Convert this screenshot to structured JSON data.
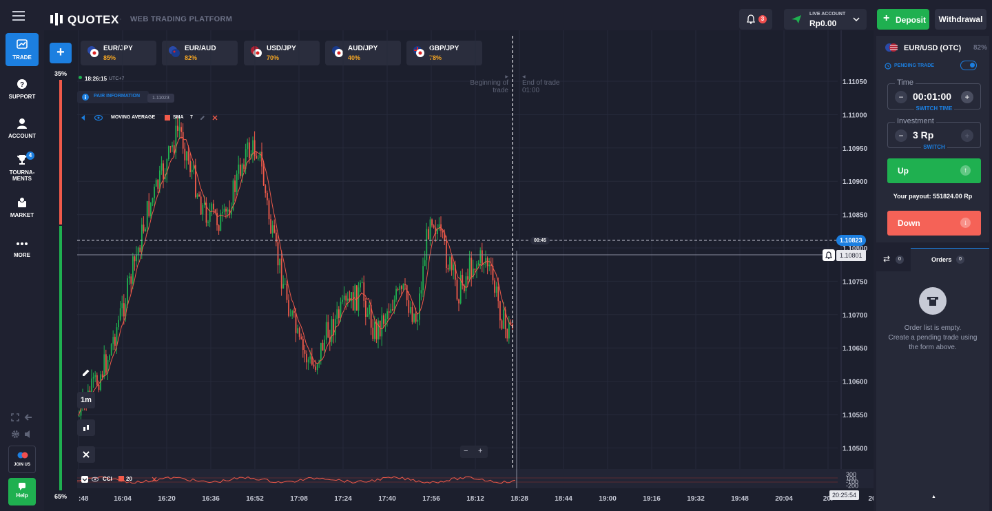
{
  "header": {
    "logo_text": "QUOTEX",
    "logo_sep": "·",
    "platform_label": "WEB TRADING PLATFORM",
    "notification_count": "3",
    "account_label": "LIVE ACCOUNT",
    "balance": "Rp0.00",
    "deposit_label": "Deposit",
    "withdraw_label": "Withdrawal"
  },
  "sidebar": {
    "items": [
      {
        "label": "TRADE",
        "icon": "chart-icon"
      },
      {
        "label": "SUPPORT",
        "icon": "help-icon"
      },
      {
        "label": "ACCOUNT",
        "icon": "user-icon"
      },
      {
        "label": "TOURNA-\nMENTS",
        "label1": "TOURNA-",
        "label2": "MENTS",
        "icon": "trophy-icon",
        "badge": "4"
      },
      {
        "label": "MARKET",
        "icon": "market-icon"
      },
      {
        "label": "MORE",
        "icon": "more-icon"
      }
    ],
    "join_label": "JOIN US",
    "help_label": "Help"
  },
  "assets": [
    {
      "name": "EUR/JPY",
      "payout": "85%"
    },
    {
      "name": "EUR/AUD",
      "payout": "82%"
    },
    {
      "name": "USD/JPY",
      "payout": "70%"
    },
    {
      "name": "AUD/JPY",
      "payout": "40%"
    },
    {
      "name": "GBP/JPY",
      "payout": "78%"
    }
  ],
  "chart": {
    "sentiment_up": "35%",
    "sentiment_down": "65%",
    "clock": "18:26:15",
    "timezone": "UTC+7",
    "pair_info_label": "PAIR INFORMATION",
    "hover_price": "1.11023",
    "indicator_name": "MOVING AVERAGE",
    "indicator_type": "SMA",
    "indicator_period": "7",
    "begin_trade_label": "Beginning of trade",
    "end_trade_label": "End of trade",
    "end_trade_time": "01:00",
    "countdown": "00:45",
    "current_price": "1.10823",
    "alert_price": "1.10801",
    "timeframe": "1m",
    "cci_label": "CCI",
    "cci_period": "20",
    "cci_ticks": [
      "300",
      "100",
      "-100",
      "-200"
    ],
    "cursor_time": "20:25:54",
    "zoom_minus": "−",
    "zoom_plus": "+",
    "price_ticks": [
      "1.11050",
      "1.11000",
      "1.10950",
      "1.10900",
      "1.10850",
      "1.10800",
      "1.10750",
      "1.10700",
      "1.10650",
      "1.10600",
      "1.10550",
      "1.10500"
    ],
    "time_ticks": [
      ":48",
      "16:04",
      "16:20",
      "16:36",
      "16:52",
      "17:08",
      "17:24",
      "17:40",
      "17:56",
      "18:12",
      "18:28",
      "18:44",
      "19:00",
      "19:16",
      "19:32",
      "19:48",
      "20:04",
      "20:",
      "20"
    ],
    "colors": {
      "up": "#1fb050",
      "down": "#f05a4a",
      "accent": "#1c7fe0"
    }
  },
  "panel": {
    "asset": "EUR/USD (OTC)",
    "payout": "82%",
    "pending_label": "PENDING TRADE",
    "time_label": "Time",
    "time_value": "00:01:00",
    "switch_time_label": "SWITCH TIME",
    "investment_label": "Investment",
    "investment_value": "3 Rp",
    "switch_label": "SWITCH",
    "up_label": "Up",
    "payout_label": "Your payout:",
    "payout_value": "551824.00 Rp",
    "down_label": "Down",
    "trades_count": "0",
    "orders_label": "Orders",
    "orders_count": "0",
    "empty_line1": "Order list is empty.",
    "empty_line2": "Create a pending trade using",
    "empty_line3": "the form above."
  }
}
